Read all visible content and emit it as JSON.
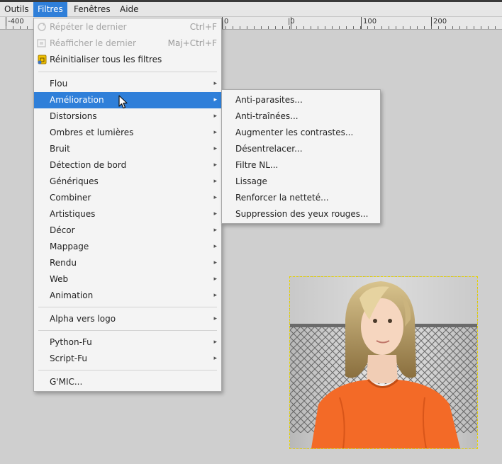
{
  "menubar": {
    "items": [
      "Outils",
      "Filtres",
      "Fenêtres",
      "Aide"
    ],
    "active_index": 1
  },
  "ruler": {
    "labels": [
      "-400",
      "0",
      "|0",
      "100",
      "200"
    ]
  },
  "filters_menu": {
    "top_items": [
      {
        "label": "Répéter le dernier",
        "accel": "Ctrl+F",
        "icon": "repeat-icon",
        "disabled": true
      },
      {
        "label": "Réafficher le dernier",
        "accel": "Maj+Ctrl+F",
        "icon": "reshow-icon",
        "disabled": true
      },
      {
        "label": "Réinitialiser tous les filtres",
        "accel": "",
        "icon": "reset-icon",
        "disabled": false
      }
    ],
    "submenus": [
      "Flou",
      "Amélioration",
      "Distorsions",
      "Ombres et lumières",
      "Bruit",
      "Détection de bord",
      "Génériques",
      "Combiner",
      "Artistiques",
      "Décor",
      "Mappage",
      "Rendu",
      "Web",
      "Animation"
    ],
    "highlighted": "Amélioration",
    "group2": [
      "Alpha vers logo"
    ],
    "group3": [
      "Python-Fu",
      "Script-Fu"
    ],
    "group4": [
      "G'MIC..."
    ]
  },
  "enhance_submenu": {
    "items": [
      "Anti-parasites...",
      "Anti-traînées...",
      "Augmenter les contrastes...",
      "Désentrelacer...",
      "Filtre NL...",
      "Lissage",
      "Renforcer la netteté...",
      "Suppression des yeux rouges..."
    ]
  },
  "colors": {
    "highlight": "#2f7fd9",
    "menu_bg": "#f4f4f4",
    "canvas_bg": "#cfcfcf",
    "shirt": "#f36a27"
  }
}
